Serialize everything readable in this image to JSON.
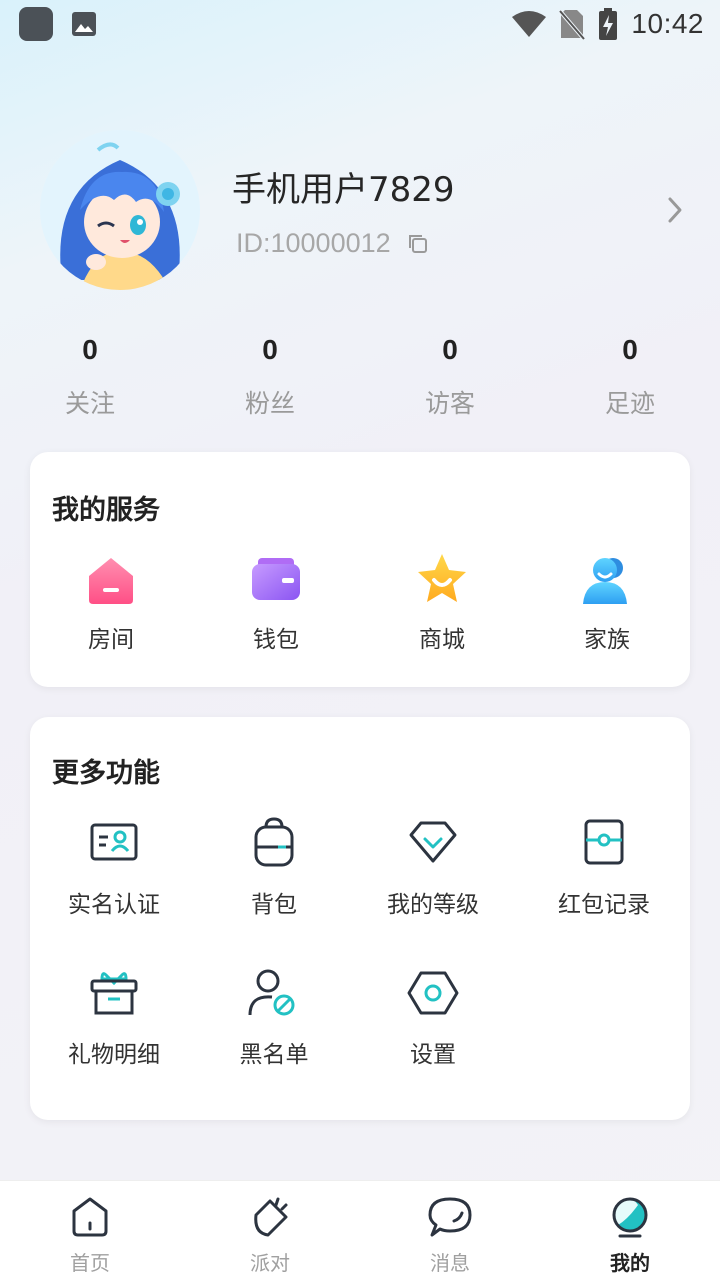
{
  "status_bar": {
    "time": "10:42"
  },
  "profile": {
    "username": "手机用户7829",
    "user_id": "ID:10000012"
  },
  "stats": [
    {
      "value": "0",
      "label": "关注"
    },
    {
      "value": "0",
      "label": "粉丝"
    },
    {
      "value": "0",
      "label": "访客"
    },
    {
      "value": "0",
      "label": "足迹"
    }
  ],
  "services": {
    "title": "我的服务",
    "items": [
      {
        "label": "房间",
        "icon": "room-icon"
      },
      {
        "label": "钱包",
        "icon": "wallet-icon"
      },
      {
        "label": "商城",
        "icon": "mall-icon"
      },
      {
        "label": "家族",
        "icon": "family-icon"
      }
    ]
  },
  "more": {
    "title": "更多功能",
    "items": [
      {
        "label": "实名认证",
        "icon": "id-card-icon"
      },
      {
        "label": "背包",
        "icon": "backpack-icon"
      },
      {
        "label": "我的等级",
        "icon": "level-icon"
      },
      {
        "label": "红包记录",
        "icon": "red-packet-icon"
      },
      {
        "label": "礼物明细",
        "icon": "gift-icon"
      },
      {
        "label": "黑名单",
        "icon": "blocked-user-icon"
      },
      {
        "label": "设置",
        "icon": "settings-icon"
      }
    ]
  },
  "nav": {
    "items": [
      {
        "label": "首页",
        "icon": "home-icon"
      },
      {
        "label": "派对",
        "icon": "party-icon"
      },
      {
        "label": "消息",
        "icon": "message-icon"
      },
      {
        "label": "我的",
        "icon": "profile-icon",
        "active": true
      }
    ]
  },
  "colors": {
    "accent_teal": "#22c1c3",
    "icon_dark": "#2c3440",
    "label_gray": "#9a9a9a"
  }
}
